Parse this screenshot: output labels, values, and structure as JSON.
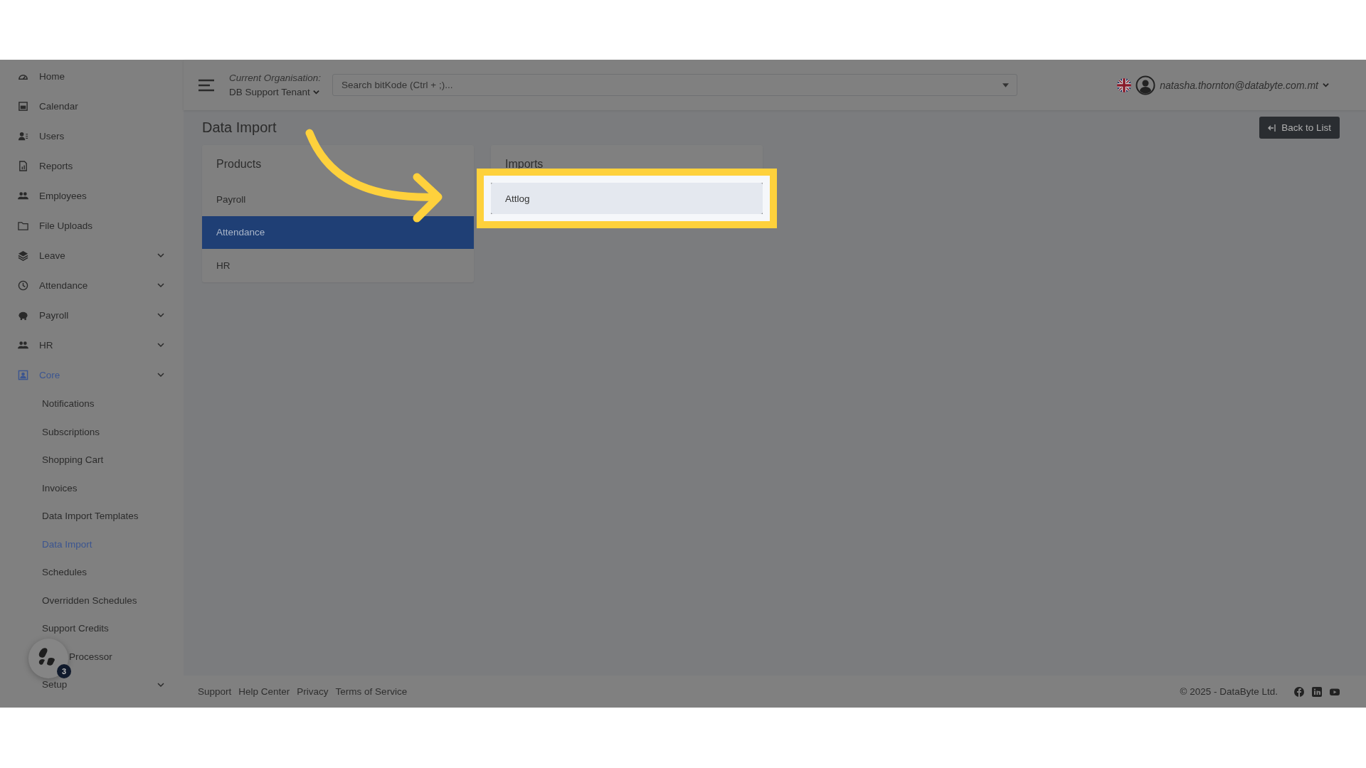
{
  "header": {
    "org_label": "Current Organisation:",
    "org_name": "DB Support Tenant",
    "search": {
      "placeholder": "Search bitKode (Ctrl + ;)..."
    },
    "user_email": "natasha.thornton@databyte.com.mt"
  },
  "sidebar": {
    "items": [
      {
        "label": "Home",
        "expandable": false,
        "selected": false
      },
      {
        "label": "Calendar",
        "expandable": false,
        "selected": false
      },
      {
        "label": "Users",
        "expandable": false,
        "selected": false
      },
      {
        "label": "Reports",
        "expandable": false,
        "selected": false
      },
      {
        "label": "Employees",
        "expandable": false,
        "selected": false
      },
      {
        "label": "File Uploads",
        "expandable": false,
        "selected": false
      },
      {
        "label": "Leave",
        "expandable": true,
        "selected": false
      },
      {
        "label": "Attendance",
        "expandable": true,
        "selected": false
      },
      {
        "label": "Payroll",
        "expandable": true,
        "selected": false
      },
      {
        "label": "HR",
        "expandable": true,
        "selected": false
      },
      {
        "label": "Core",
        "expandable": true,
        "selected": true,
        "children": [
          {
            "label": "Notifications",
            "selected": false,
            "expandable": false
          },
          {
            "label": "Subscriptions",
            "selected": false,
            "expandable": false
          },
          {
            "label": "Shopping Cart",
            "selected": false,
            "expandable": false
          },
          {
            "label": "Invoices",
            "selected": false,
            "expandable": false
          },
          {
            "label": "Data Import Templates",
            "selected": false,
            "expandable": false
          },
          {
            "label": "Data Import",
            "selected": true,
            "expandable": false
          },
          {
            "label": "Schedules",
            "selected": false,
            "expandable": false
          },
          {
            "label": "Overridden Schedules",
            "selected": false,
            "expandable": false
          },
          {
            "label": "Support Credits",
            "selected": false,
            "expandable": false
          },
          {
            "label": "Processor",
            "selected": false,
            "expandable": false,
            "obscured": true
          },
          {
            "label": "Setup",
            "selected": false,
            "expandable": true
          }
        ]
      }
    ]
  },
  "page": {
    "title": "Data Import",
    "back_button": "Back to List"
  },
  "products": {
    "title": "Products",
    "items": [
      {
        "label": "Payroll",
        "selected": false
      },
      {
        "label": "Attendance",
        "selected": true
      },
      {
        "label": "HR",
        "selected": false
      }
    ]
  },
  "imports": {
    "title": "Imports",
    "items": [
      {
        "label": "Attlog",
        "highlighted": true
      }
    ]
  },
  "chat_widget": {
    "badge": "3"
  },
  "footer": {
    "links": [
      "Support",
      "Help Center",
      "Privacy",
      "Terms of Service"
    ],
    "copyright": "© 2025 - DataByte Ltd."
  }
}
